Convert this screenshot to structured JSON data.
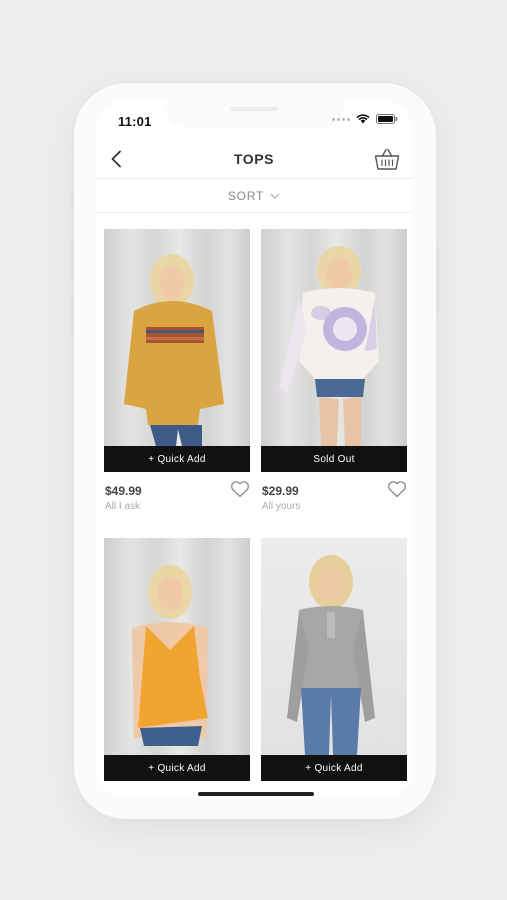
{
  "status": {
    "time": "11:01"
  },
  "nav": {
    "title": "TOPS",
    "back_icon": "chevron-left-icon",
    "cart_icon": "basket-icon"
  },
  "sort": {
    "label": "SORT",
    "icon": "chevron-down-icon"
  },
  "products": [
    {
      "price": "$49.99",
      "name": "All I ask",
      "action": "+ Quick Add"
    },
    {
      "price": "$29.99",
      "name": "All yours",
      "action": "Sold Out"
    },
    {
      "price": "",
      "name": "",
      "action": "+ Quick Add"
    },
    {
      "price": "",
      "name": "",
      "action": "+ Quick Add"
    }
  ],
  "colors": {
    "cta_bg": "#111111",
    "background": "#ededed",
    "mustard_top": "#d9a441",
    "orange_top": "#f0a530",
    "tiedye_lavender": "#b5a6d8",
    "grey_henley": "#a9a6a6"
  }
}
